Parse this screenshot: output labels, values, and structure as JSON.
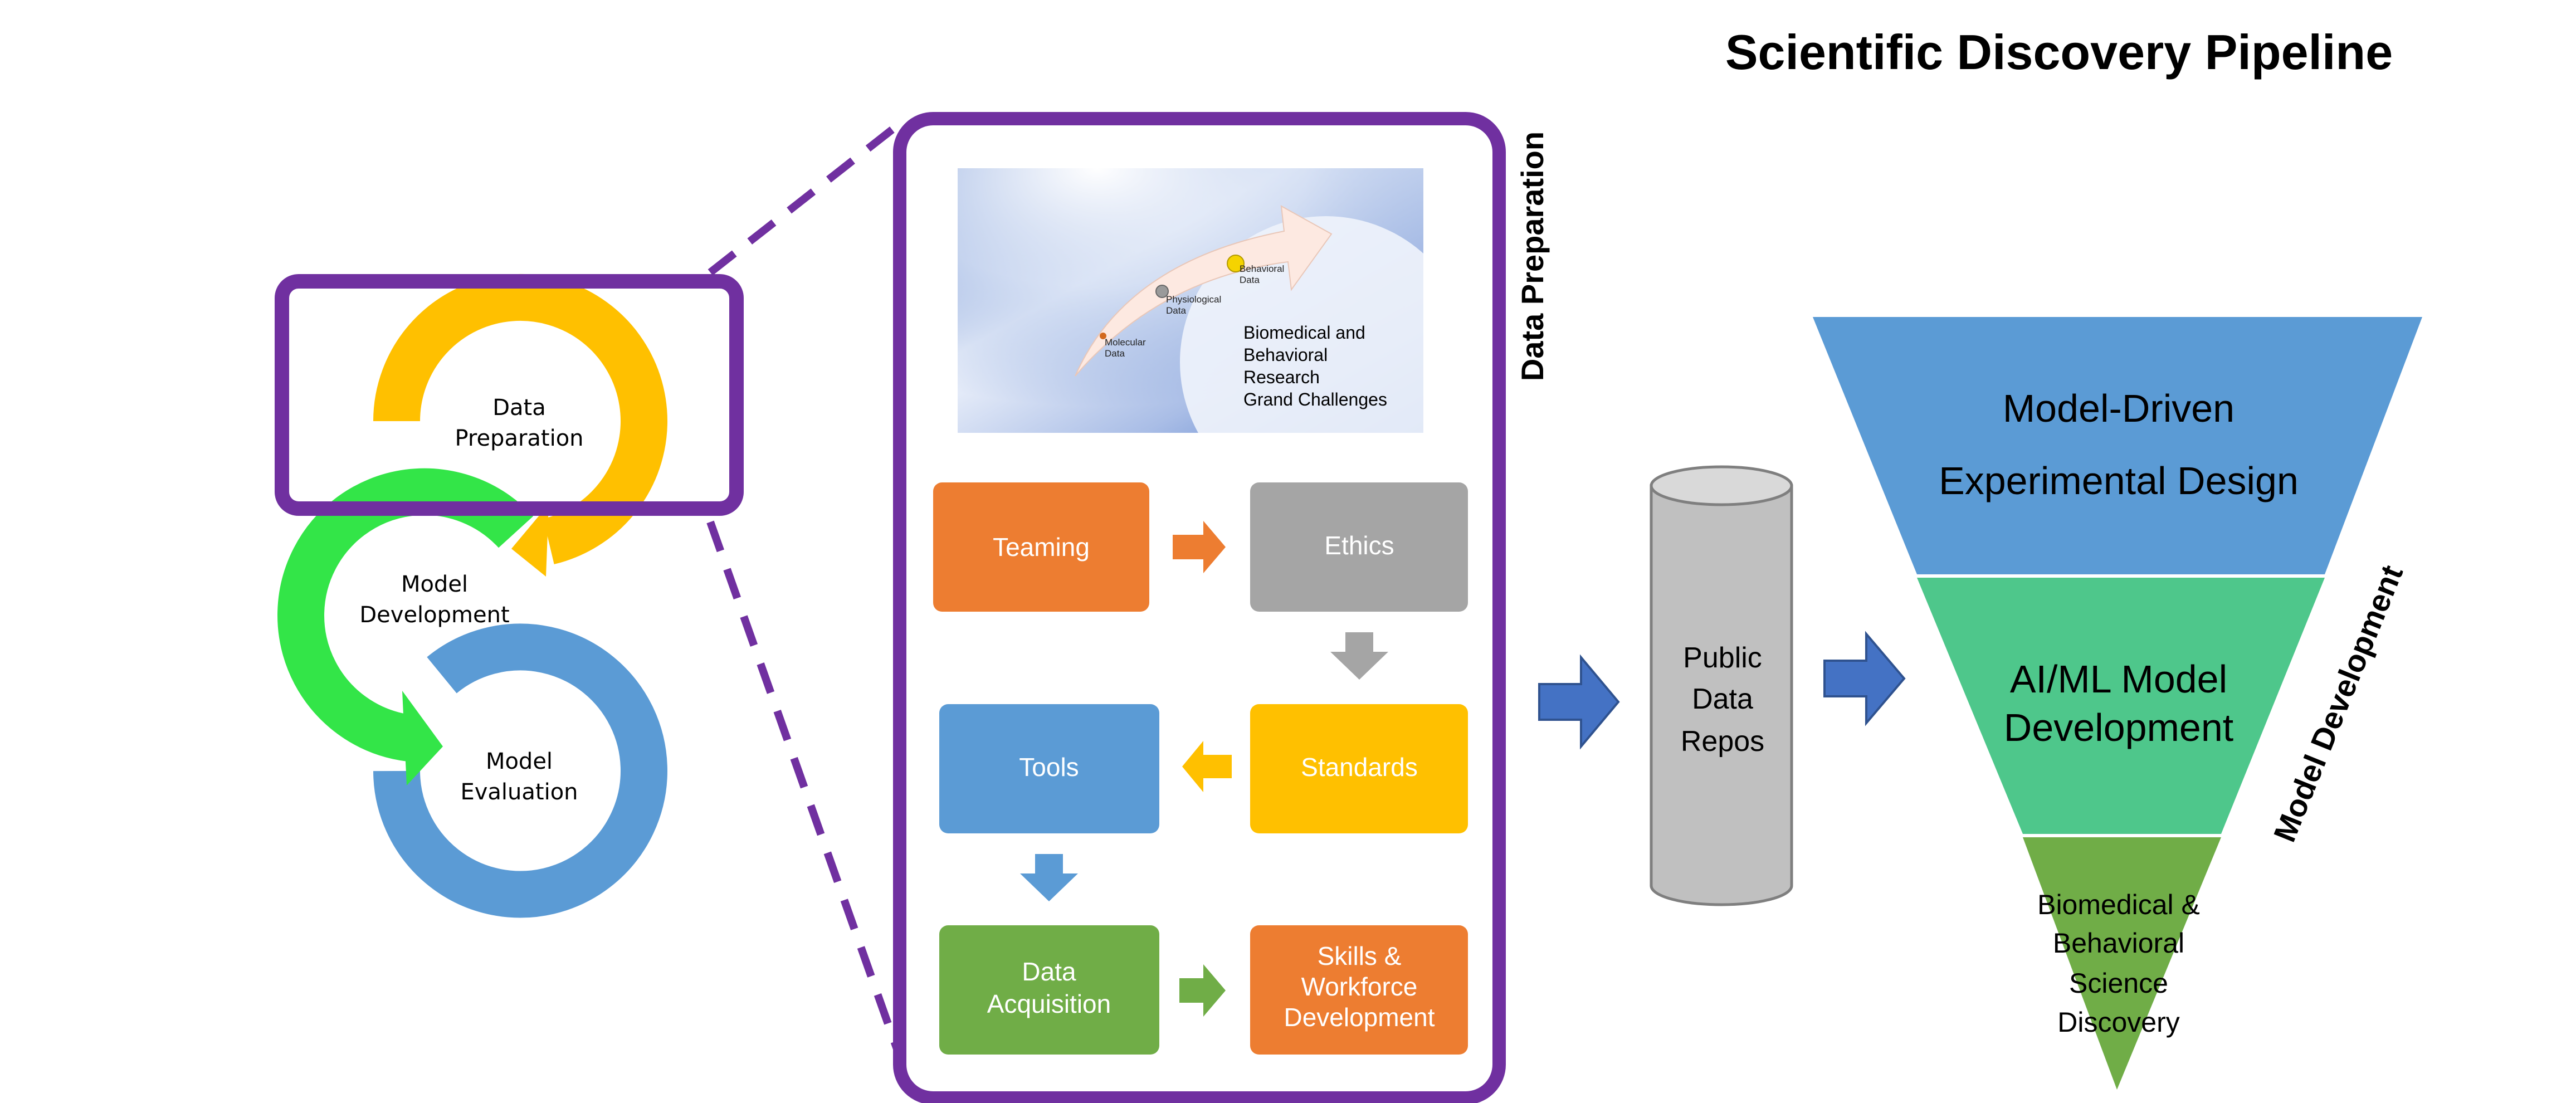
{
  "title": "Scientific Discovery Pipeline",
  "cycle": {
    "items": [
      {
        "line1": "Data",
        "line2": "Preparation",
        "color": "#FFC000"
      },
      {
        "line1": "Model",
        "line2": "Development",
        "color": "#33E548"
      },
      {
        "line1": "Model",
        "line2": "Evaluation",
        "color": "#5B9BD5"
      }
    ],
    "highlight_color": "#7030A0"
  },
  "data_preparation_panel": {
    "side_label": "Data Preparation",
    "image": {
      "stages": [
        {
          "line1": "Molecular",
          "line2": "Data"
        },
        {
          "line1": "Physiological",
          "line2": "Data"
        },
        {
          "line1": "Behavioral",
          "line2": "Data"
        }
      ],
      "caption": [
        "Biomedical and",
        "Behavioral",
        "Research",
        "Grand Challenges"
      ]
    },
    "steps": [
      {
        "lines": [
          "Teaming"
        ],
        "color": "#ED7D31"
      },
      {
        "lines": [
          "Ethics"
        ],
        "color": "#A5A5A5"
      },
      {
        "lines": [
          "Standards"
        ],
        "color": "#FFC000"
      },
      {
        "lines": [
          "Tools"
        ],
        "color": "#5B9BD5"
      },
      {
        "lines": [
          "Data",
          "Acquisition"
        ],
        "color": "#70AD47"
      },
      {
        "lines": [
          "Skills &",
          "Workforce",
          "Development"
        ],
        "color": "#ED7D31"
      }
    ]
  },
  "repository": {
    "lines": [
      "Public",
      "Data",
      "Repos"
    ],
    "color": "#C0C0C0"
  },
  "flow_arrow_color": "#4472C4",
  "funnel": {
    "side_label": "Model Development",
    "levels": [
      {
        "lines": [
          "Model-Driven",
          "Experimental Design"
        ],
        "color": "#5B9BD5"
      },
      {
        "lines": [
          "AI/ML Model",
          "Development"
        ],
        "color": "#4EC78B"
      },
      {
        "lines": [
          "Biomedical &",
          "Behavioral",
          "Science",
          "Discovery"
        ],
        "color": "#70AD47"
      }
    ]
  }
}
